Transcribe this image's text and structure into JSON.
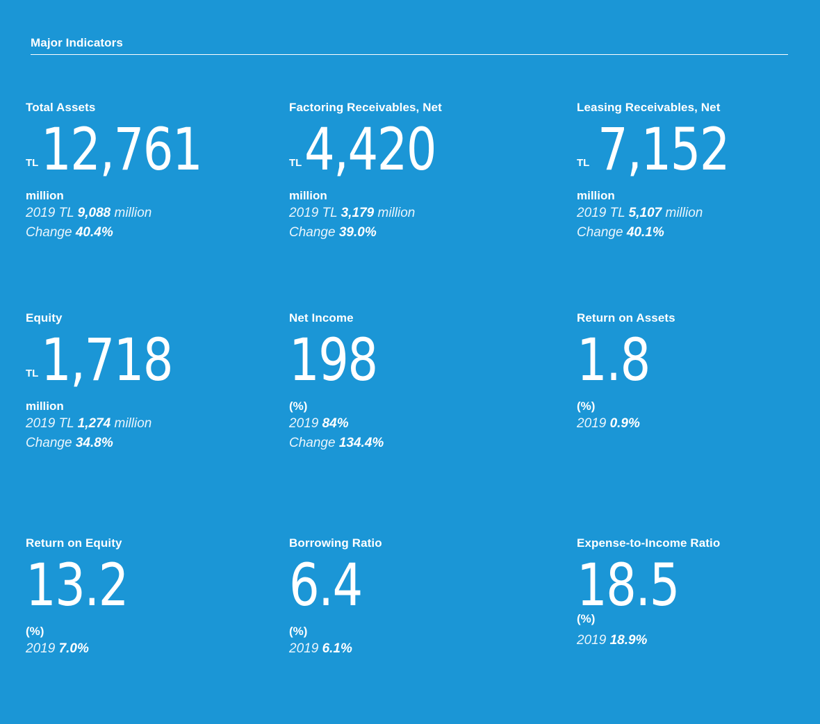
{
  "header": {
    "title": "Major Indicators"
  },
  "cards": [
    {
      "label": "Total Assets",
      "prefix": "TL",
      "value": "12,761",
      "unit": "million",
      "prev_pre": "2019 TL",
      "prev_val": "9,088",
      "prev_post": "million",
      "change_pre": "Change",
      "change_val": "40.4%"
    },
    {
      "label": "Factoring Receivables, Net",
      "prefix": "TL",
      "value": "4,420",
      "unit": "million",
      "prev_pre": "2019 TL",
      "prev_val": "3,179",
      "prev_post": "million",
      "change_pre": "Change",
      "change_val": "39.0%"
    },
    {
      "label": "Leasing Receivables, Net",
      "prefix": "TL",
      "value": "7,152",
      "unit": "million",
      "prev_pre": "2019 TL",
      "prev_val": "5,107",
      "prev_post": "million",
      "change_pre": "Change",
      "change_val": "40.1%"
    },
    {
      "label": "Equity",
      "prefix": "TL",
      "value": "1,718",
      "unit": "million",
      "prev_pre": "2019 TL",
      "prev_val": "1,274",
      "prev_post": "million",
      "change_pre": "Change",
      "change_val": "34.8%"
    },
    {
      "label": "Net Income",
      "prefix": "",
      "value": "198",
      "unit": "(%)",
      "prev_pre": "2019",
      "prev_val": "84%",
      "prev_post": "",
      "change_pre": "Change",
      "change_val": "134.4%"
    },
    {
      "label": "Return on Assets",
      "prefix": "",
      "value": "1.8",
      "unit": "(%)",
      "prev_pre": "2019",
      "prev_val": "0.9%",
      "prev_post": "",
      "change_pre": "",
      "change_val": ""
    },
    {
      "label": "Return on Equity",
      "prefix": "",
      "value": "13.2",
      "unit": "(%)",
      "prev_pre": "2019",
      "prev_val": "7.0%",
      "prev_post": "",
      "change_pre": "",
      "change_val": ""
    },
    {
      "label": "Borrowing Ratio",
      "prefix": "",
      "value": "6.4",
      "unit": "(%)",
      "prev_pre": "2019",
      "prev_val": "6.1%",
      "prev_post": "",
      "change_pre": "",
      "change_val": ""
    },
    {
      "label": "Expense-to-Income Ratio",
      "prefix": "",
      "value": "18.5",
      "unit": "(%)",
      "prev_pre": "2019",
      "prev_val": "18.9%",
      "prev_post": "",
      "change_pre": "",
      "change_val": ""
    }
  ]
}
